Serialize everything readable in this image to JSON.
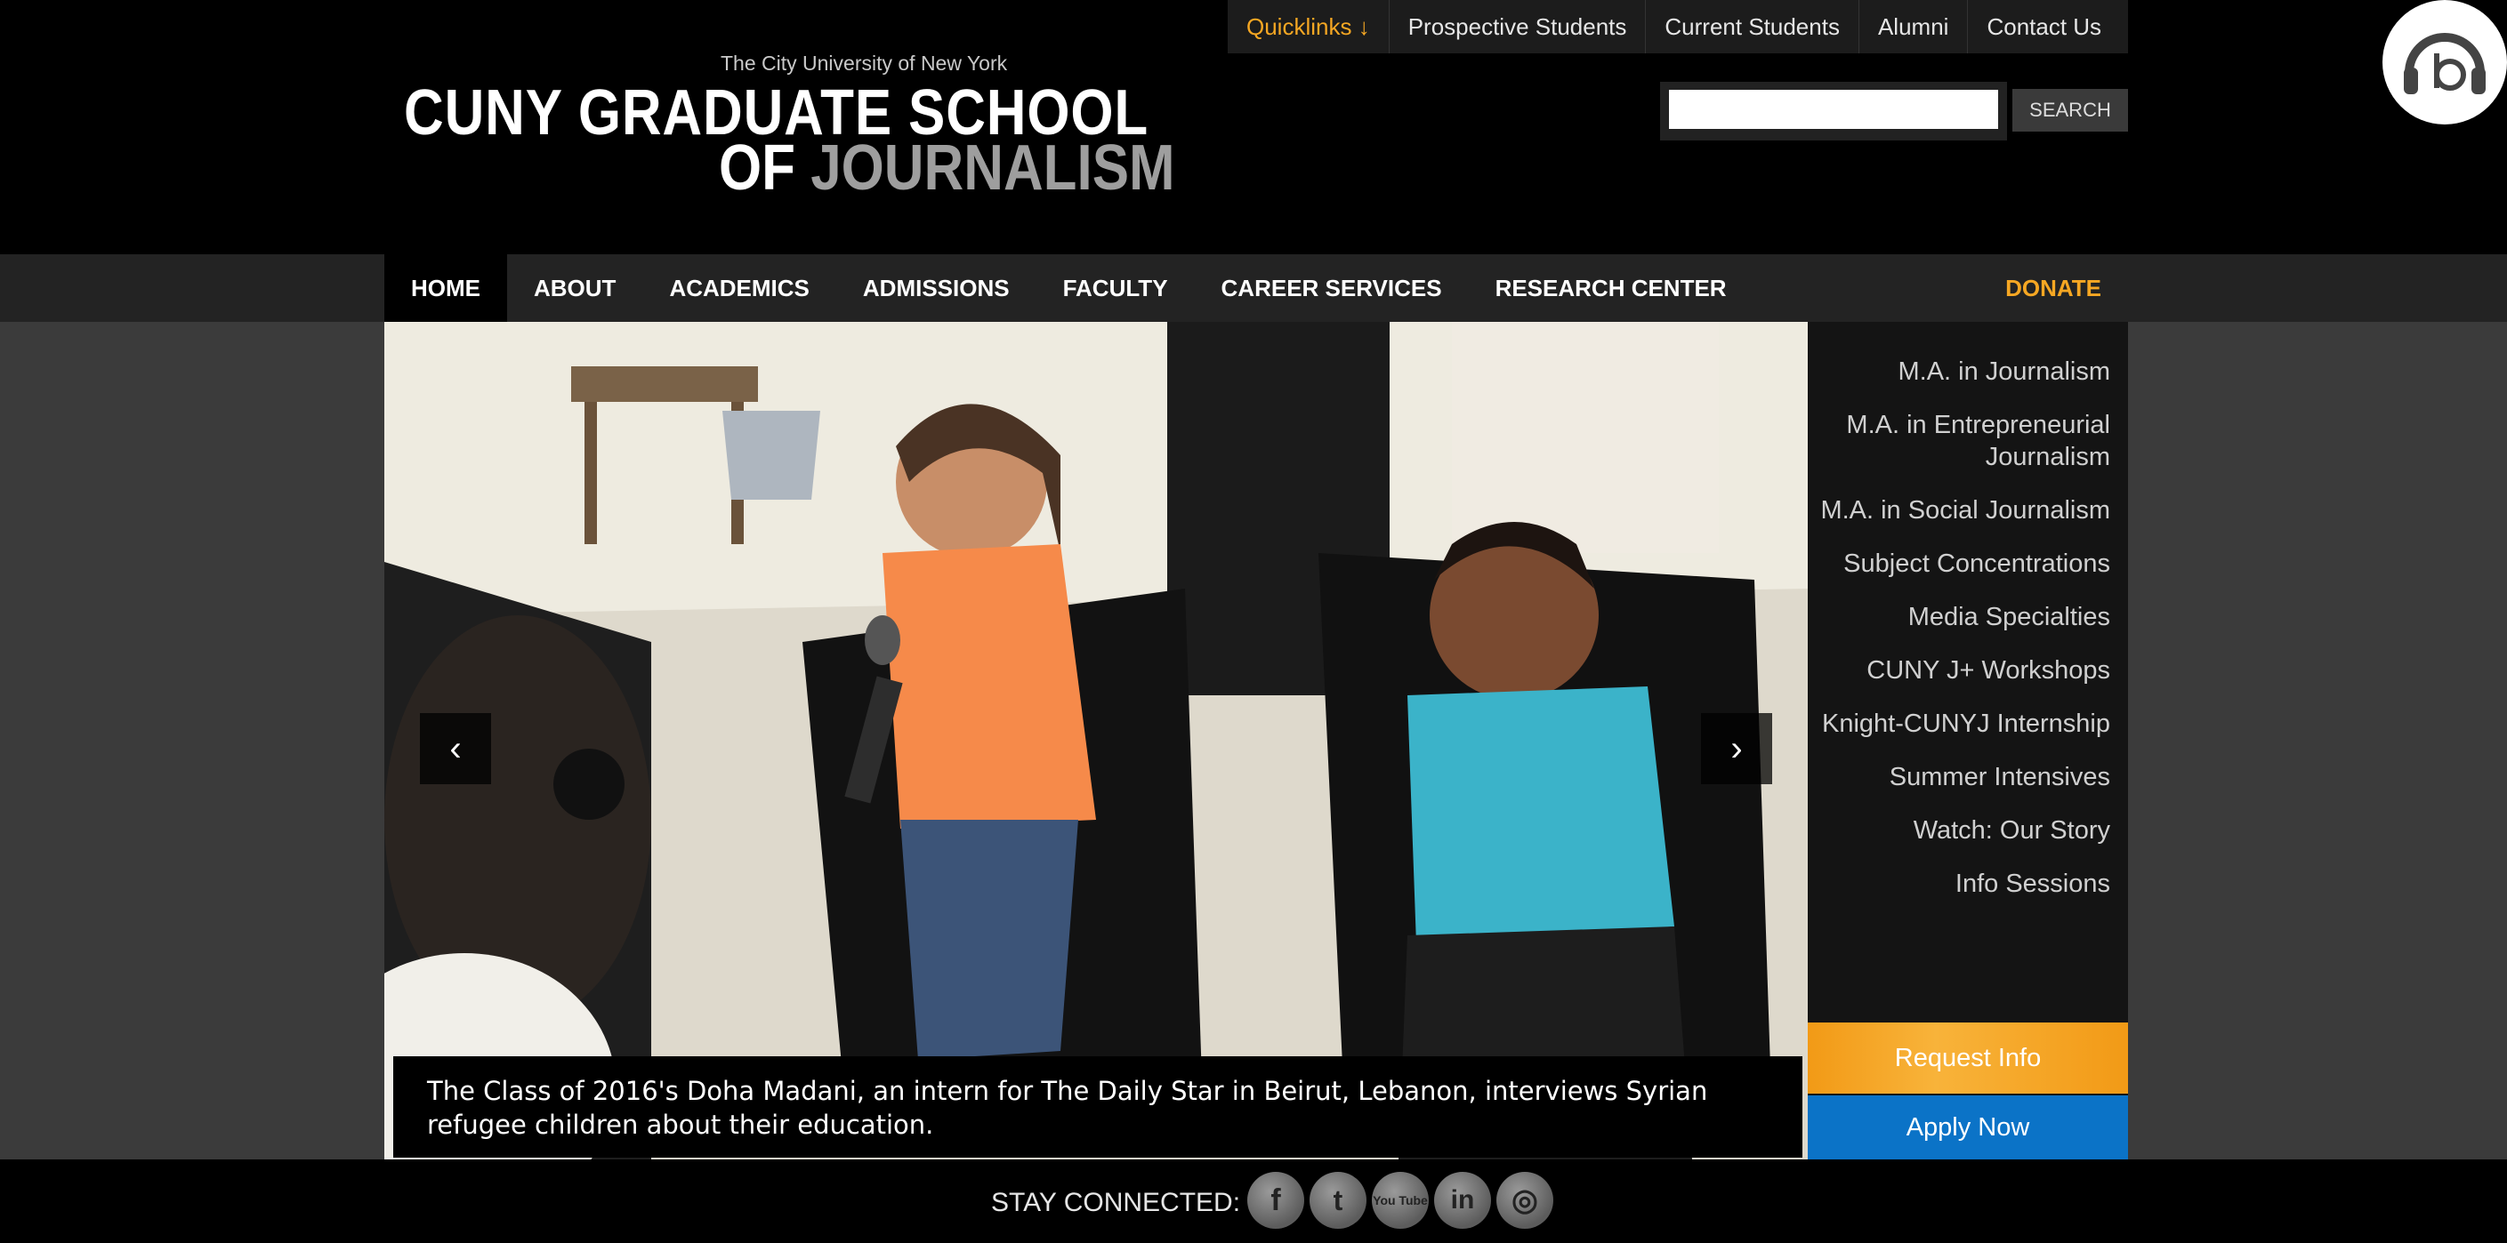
{
  "logo": {
    "kicker": "The City University of New York",
    "line1": "CUNY GRADUATE SCHOOL",
    "line2_a": "OF ",
    "line2_b": "JOURNALISM"
  },
  "quicklinks": [
    {
      "label": "Quicklinks ↓"
    },
    {
      "label": "Prospective Students"
    },
    {
      "label": "Current Students"
    },
    {
      "label": "Alumni"
    },
    {
      "label": "Contact Us"
    }
  ],
  "search": {
    "value": "",
    "button_label": "SEARCH"
  },
  "nav": {
    "items": [
      {
        "label": "HOME"
      },
      {
        "label": "ABOUT"
      },
      {
        "label": "ACADEMICS"
      },
      {
        "label": "ADMISSIONS"
      },
      {
        "label": "FACULTY"
      },
      {
        "label": "CAREER SERVICES"
      },
      {
        "label": "RESEARCH CENTER"
      }
    ],
    "donate": "DONATE"
  },
  "hero": {
    "prev_icon": "chevron-left-icon",
    "next_icon": "chevron-right-icon",
    "caption": "The Class of 2016's Doha Madani, an intern for The Daily Star in Beirut, Lebanon, interviews Syrian refugee children about their education."
  },
  "sidebar": {
    "items": [
      {
        "label": "M.A. in Journalism"
      },
      {
        "label": "M.A. in Entrepreneurial Journalism"
      },
      {
        "label": "M.A. in Social Journalism"
      },
      {
        "label": "Subject Concentrations"
      },
      {
        "label": "Media Specialties"
      },
      {
        "label": "CUNY J+ Workshops"
      },
      {
        "label": "Knight-CUNYJ Internship"
      },
      {
        "label": "Summer Intensives"
      },
      {
        "label": "Watch: Our Story"
      },
      {
        "label": "Info Sessions"
      }
    ],
    "request_info": "Request Info",
    "apply_now": "Apply Now"
  },
  "footer": {
    "stay_connected": "STAY CONNECTED:",
    "social": [
      {
        "icon": "facebook-icon",
        "glyph": "f"
      },
      {
        "icon": "twitter-icon",
        "glyph": "t"
      },
      {
        "icon": "youtube-icon",
        "glyph": "You Tube"
      },
      {
        "icon": "linkedin-icon",
        "glyph": "in"
      },
      {
        "icon": "instagram-icon",
        "glyph": "◎"
      }
    ]
  },
  "colors": {
    "accent_orange": "#f6a723",
    "apply_blue": "#0b73c7",
    "background": "#3b3b3b"
  }
}
